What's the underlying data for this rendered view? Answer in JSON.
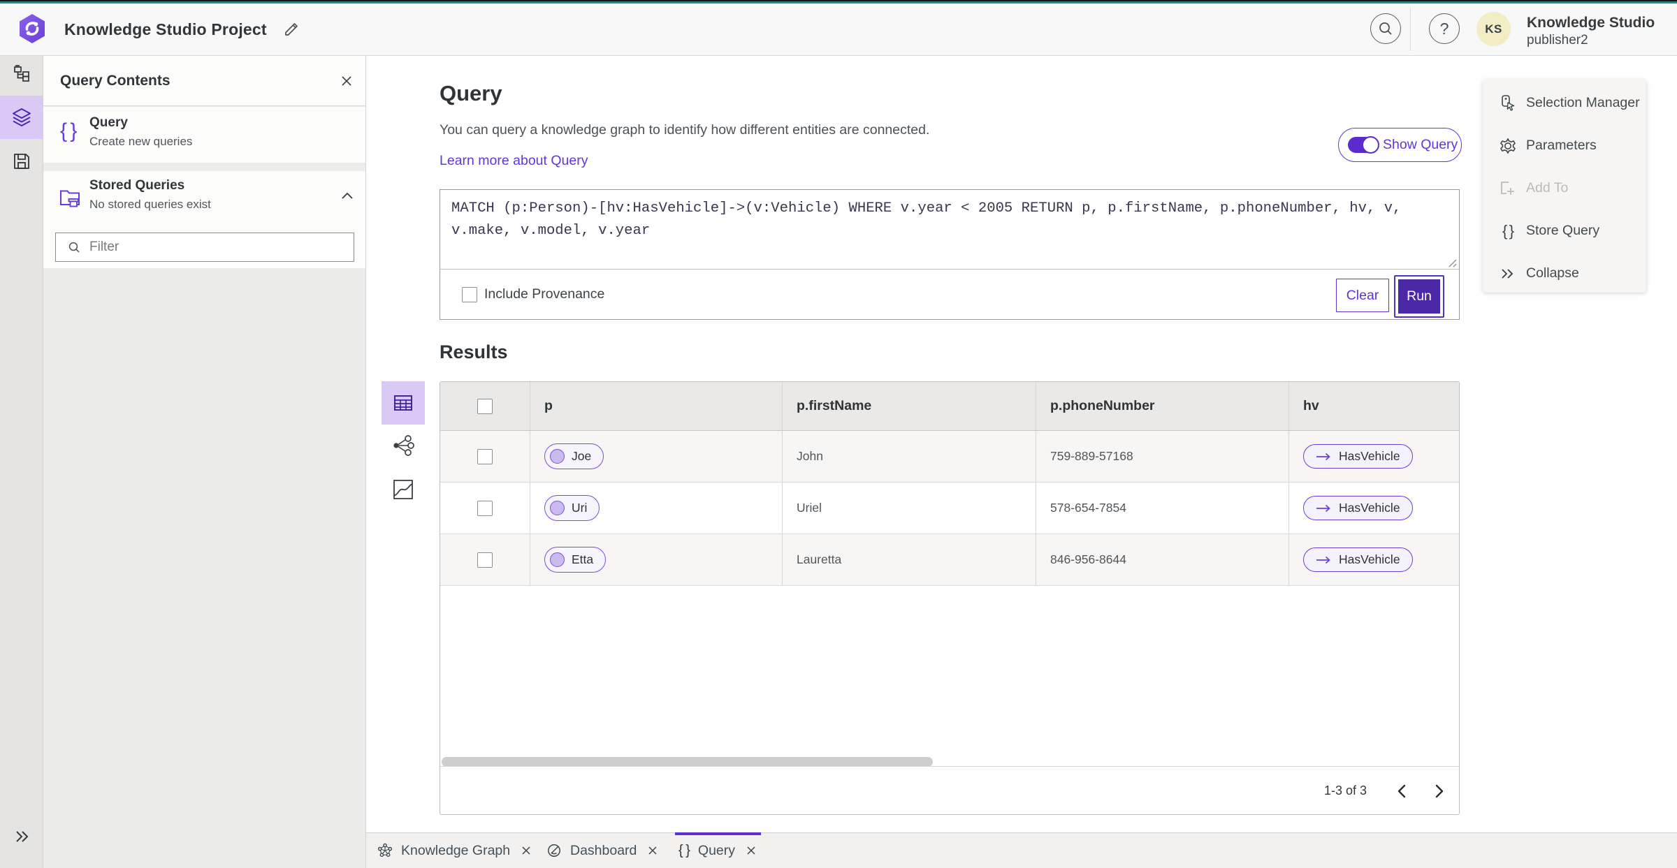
{
  "colors": {
    "brand_teal": "#387e82",
    "accent_purple": "#6137d8",
    "deep_purple": "#4b28a5",
    "rail_active_bg": "#d9c9f4",
    "pill_bg": "#f6f4fc",
    "header_bg": "#f8f8f8",
    "table_header_bg": "#ebe9e7",
    "row_alt_bg": "#f7f6f4"
  },
  "header": {
    "project_title": "Knowledge Studio Project",
    "account_name": "Knowledge Studio",
    "account_role": "publisher2",
    "avatar_initials": "KS",
    "help_glyph": "?"
  },
  "left_panel": {
    "title": "Query Contents",
    "query_item_icon": "{ }",
    "query_item_title": "Query",
    "query_item_subtitle": "Create new queries",
    "stored_title": "Stored Queries",
    "stored_subtitle": "No stored queries exist",
    "filter_placeholder": "Filter"
  },
  "query_panel": {
    "heading": "Query",
    "description": "You can query a knowledge graph to identify how different entities are connected.",
    "learn_more_label": "Learn more about Query",
    "show_query_label": "Show Query",
    "query_text": "MATCH (p:Person)-[hv:HasVehicle]->(v:Vehicle) WHERE v.year < 2005 RETURN p, p.firstName, p.phoneNumber, hv, v, v.make, v.model, v.year",
    "include_provenance_label": "Include Provenance",
    "clear_label": "Clear",
    "run_label": "Run"
  },
  "results": {
    "heading": "Results",
    "columns": {
      "c1": "p",
      "c2": "p.firstName",
      "c3": "p.phoneNumber",
      "c4": "hv"
    },
    "rows": [
      {
        "entity": "Joe",
        "first_name": "John",
        "phone": "759-889-57168",
        "relationship": "HasVehicle"
      },
      {
        "entity": "Uri",
        "first_name": "Uriel",
        "phone": "578-654-7854",
        "relationship": "HasVehicle"
      },
      {
        "entity": "Etta",
        "first_name": "Lauretta",
        "phone": "846-956-8644",
        "relationship": "HasVehicle"
      }
    ],
    "pagination_label": "1-3 of 3"
  },
  "right_menu": {
    "items": [
      {
        "label": "Selection Manager"
      },
      {
        "label": "Parameters"
      },
      {
        "label": "Add To"
      },
      {
        "label": "Store Query"
      },
      {
        "label": "Collapse"
      }
    ]
  },
  "bottom_tabs": {
    "query_brace": "{ }",
    "tabs": [
      {
        "label": "Knowledge Graph"
      },
      {
        "label": "Dashboard"
      },
      {
        "label": "Query"
      }
    ]
  }
}
